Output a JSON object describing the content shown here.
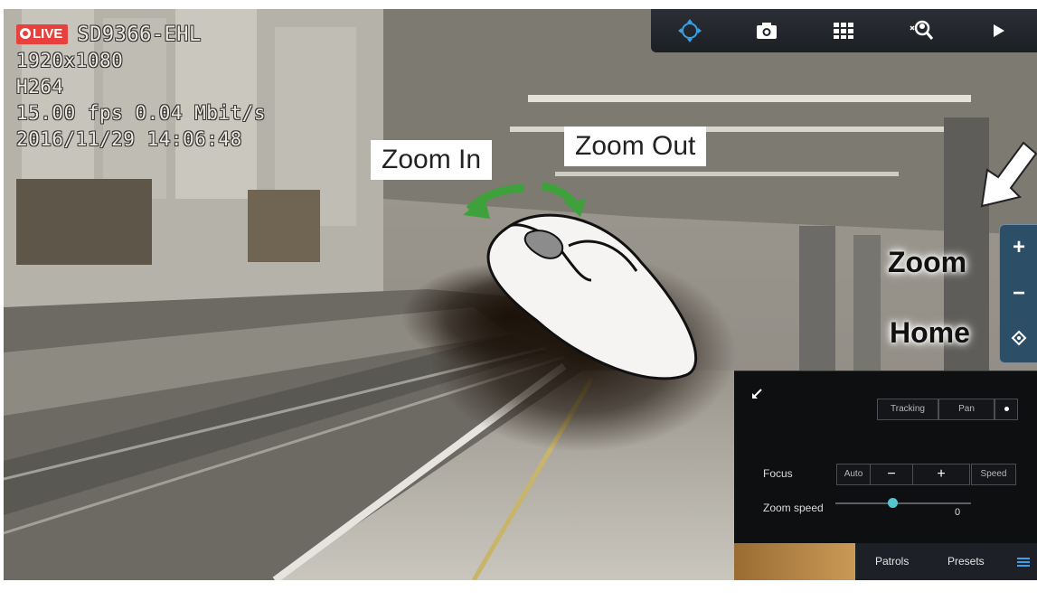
{
  "osd": {
    "live_label": "LIVE",
    "model": "SD9366-EHL",
    "resolution": "1920x1080",
    "codec": "H264",
    "rate": "15.00 fps 0.04 Mbit/s",
    "datetime": "2016/11/29 14:06:48"
  },
  "toolbar": {
    "buttons": [
      {
        "icon": "ptz-move-icon"
      },
      {
        "icon": "camera-snapshot-icon"
      },
      {
        "icon": "grid-layout-icon"
      },
      {
        "icon": "user-search-icon"
      },
      {
        "icon": "play-icon"
      }
    ]
  },
  "callouts": {
    "zoom_in": "Zoom In",
    "zoom_out": "Zoom Out",
    "zoom": "Zoom",
    "home": "Home"
  },
  "zoom_panel": {
    "plus": "+",
    "minus": "−",
    "home_icon": "home-target-icon"
  },
  "ptz_panel": {
    "tracking": "Tracking",
    "pan": "Pan",
    "focus_label": "Focus",
    "auto": "Auto",
    "minus": "−",
    "plus": "+",
    "speed": "Speed",
    "zoom_speed_label": "Zoom speed",
    "zoom_speed_value": "0",
    "tabs": [
      "Patrols",
      "Presets"
    ]
  },
  "colors": {
    "live_badge": "#e8413b",
    "toolbar_icon": "#ffffff",
    "toolbar_active_icon": "#3aa0e8",
    "zoom_panel_bg": "#2d4e67",
    "slider_thumb": "#56c5d0",
    "arrow_green": "#3fa13b"
  }
}
